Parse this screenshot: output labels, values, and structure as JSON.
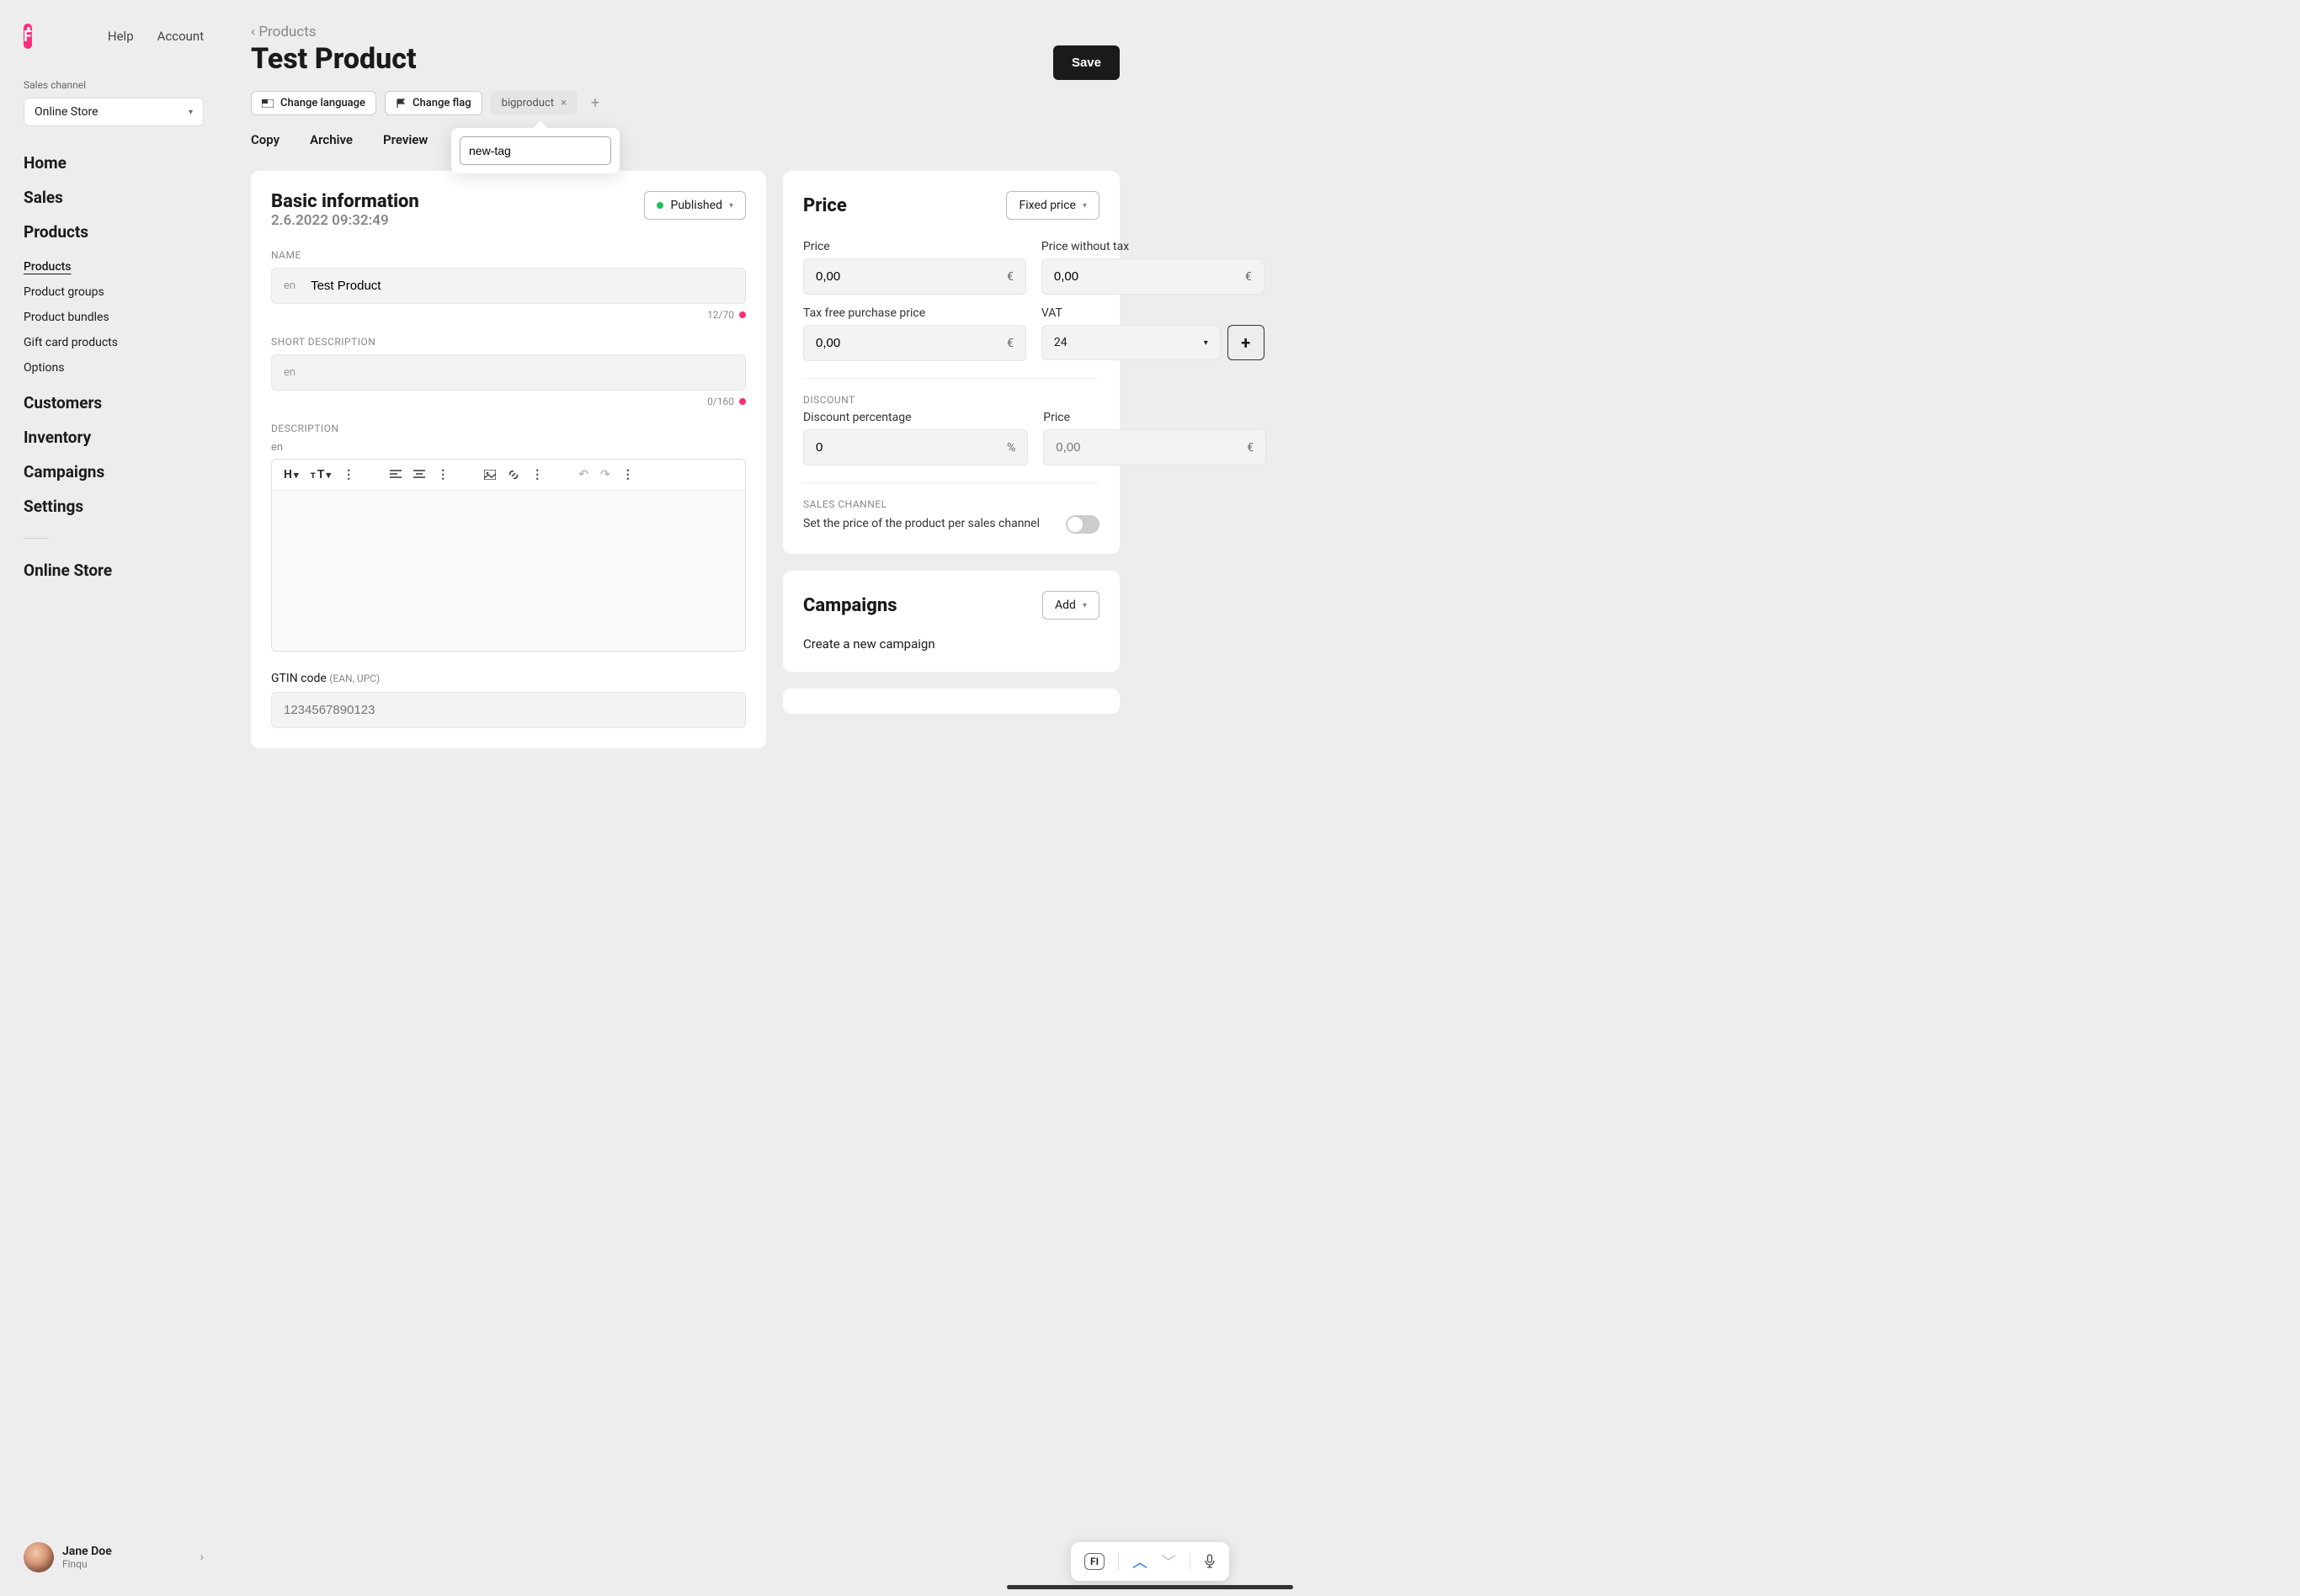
{
  "topbar": {
    "help": "Help",
    "account": "Account"
  },
  "sidebar": {
    "sales_channel_label": "Sales channel",
    "sales_channel_value": "Online Store",
    "nav": [
      {
        "label": "Home"
      },
      {
        "label": "Sales"
      },
      {
        "label": "Products",
        "sub": [
          {
            "label": "Products",
            "active": true
          },
          {
            "label": "Product groups"
          },
          {
            "label": "Product bundles"
          },
          {
            "label": "Gift card products"
          },
          {
            "label": "Options"
          }
        ]
      },
      {
        "label": "Customers"
      },
      {
        "label": "Inventory"
      },
      {
        "label": "Campaigns"
      },
      {
        "label": "Settings"
      }
    ],
    "online_store": "Online Store",
    "user": {
      "name": "Jane Doe",
      "org": "Finqu"
    }
  },
  "header": {
    "breadcrumb": "Products",
    "title": "Test Product",
    "save": "Save"
  },
  "chips": {
    "change_language": "Change language",
    "change_flag": "Change flag",
    "tag": "bigproduct",
    "new_tag_value": "new-tag"
  },
  "actions": {
    "copy": "Copy",
    "archive": "Archive",
    "preview": "Preview"
  },
  "basic": {
    "title": "Basic information",
    "timestamp": "2.6.2022 09:32:49",
    "status": "Published",
    "name_label": "NAME",
    "name_lang": "en",
    "name_value": "Test Product",
    "name_count": "12/70",
    "short_desc_label": "SHORT DESCRIPTION",
    "short_desc_lang": "en",
    "short_desc_count": "0/160",
    "desc_label": "DESCRIPTION",
    "desc_lang": "en",
    "gtin_label": "GTIN code",
    "gtin_sub": "(EAN, UPC)",
    "gtin_placeholder": "1234567890123"
  },
  "price": {
    "title": "Price",
    "type": "Fixed price",
    "price_label": "Price",
    "price_value": "0,00",
    "currency": "€",
    "price_without_tax_label": "Price without tax",
    "price_without_tax_value": "0,00",
    "tax_free_label": "Tax free purchase price",
    "tax_free_value": "0,00",
    "vat_label": "VAT",
    "vat_value": "24",
    "discount_section": "DISCOUNT",
    "discount_pct_label": "Discount percentage",
    "discount_pct_value": "0",
    "pct": "%",
    "discount_price_label": "Price",
    "discount_price_value": "0,00",
    "sales_channel_section": "SALES CHANNEL",
    "sales_channel_text": "Set the price of the product per sales channel"
  },
  "campaigns": {
    "title": "Campaigns",
    "add": "Add",
    "create": "Create a new campaign"
  },
  "widget": {
    "lang": "FI"
  }
}
